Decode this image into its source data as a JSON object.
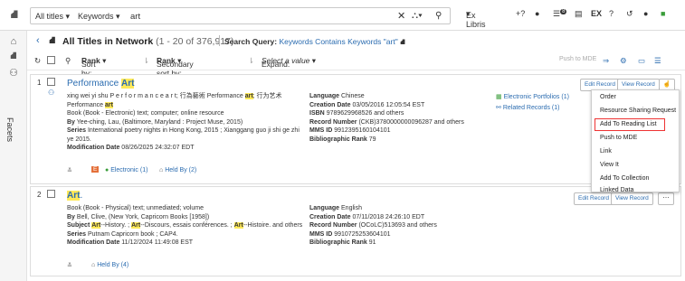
{
  "search": {
    "scope": "All titles",
    "field": "Keywords",
    "query": "art"
  },
  "header": {
    "institution": "Ex Libris",
    "notifications_badge": "8"
  },
  "left_nav": {
    "facets_label": "Facets"
  },
  "title_bar": {
    "title": "All Titles in Network",
    "count": "(1 - 20 of 376,917)",
    "search_query_label": "Search Query:",
    "search_query_value": "Keywords Contains Keywords \"art\""
  },
  "toolbar": {
    "sort_label": "Sort by:",
    "sort_value": "Rank",
    "secondary_sort_label": "Secondary sort by:",
    "secondary_sort_value": "Rank",
    "expand_label": "Expand:",
    "expand_value": "Select a value",
    "push_to_mde": "Push to MDE"
  },
  "results": [
    {
      "number": "1",
      "title_pre": "Performance ",
      "title_hl": "Art",
      "line1_pre": "xing wei yi shu P e r f o r m a n c e a r t; 行為藝術 Performance ",
      "line1_hl": "art",
      "line1_post": "; 行为艺术",
      "line2_pre": "Performance ",
      "line2_hl": "art",
      "line3": "Book (Book - Electronic) text; computer; online resource",
      "by_label": "By",
      "by_value": "Yee-ching, Lau, (Baltimore, Maryland : Project Muse, 2015)",
      "series_label": "Series",
      "series_value": "International poetry nights in Hong Kong, 2015 ; Xianggang guo ji shi ge zhi ye 2015.",
      "mod_label": "Modification Date",
      "mod_value": "08/26/2025 24:32:07 EDT",
      "language_label": "Language",
      "language_value": "Chinese",
      "creation_label": "Creation Date",
      "creation_value": "03/05/2016 12:05:54 EST",
      "isbn_label": "ISBN",
      "isbn_value": "9789629968526 and others",
      "record_label": "Record Number",
      "record_value": "(CKB)3780000000096287 and others",
      "mms_label": "MMS ID",
      "mms_value": "9912395160104101",
      "rank_label": "Bibliographic Rank",
      "rank_value": "79",
      "portfolios": "Electronic Portfolios (1)",
      "related": "Related Records (1)",
      "electronic": "Electronic (1)",
      "held_by": "Held By (2)",
      "edit_record": "Edit Record",
      "view_record": "View Record"
    },
    {
      "number": "2",
      "title_hl": "Art",
      "title_post": ".",
      "line1": "Book (Book - Physical) text; unmediated; volume",
      "by_label": "By",
      "by_value": "Bell, Clive, (New York, Capricorn Books [1958])",
      "subject_label": "Subject",
      "subject_p1": "Art",
      "subject_p2": "--History. ; ",
      "subject_p3": "Art",
      "subject_p4": "--Discours, essais conférences. ; ",
      "subject_p5": "Art",
      "subject_p6": "--Histoire. and others",
      "series_label": "Series",
      "series_value": "Putnam Capricorn book ; CAP4.",
      "mod_label": "Modification Date",
      "mod_value": "11/12/2024 11:49:08 EST",
      "language_label": "Language",
      "language_value": "English",
      "creation_label": "Creation Date",
      "creation_value": "07/11/2018 24:26:10 EDT",
      "record_label": "Record Number",
      "record_value": "(OCoLC)513693 and others",
      "mms_label": "MMS ID",
      "mms_value": "9910725253604101",
      "rank_label": "Bibliographic Rank",
      "rank_value": "91",
      "held_by": "Held By (4)",
      "edit_record": "Edit Record",
      "view_record": "View Record"
    }
  ],
  "dropdown_menu": {
    "items": [
      "Order",
      "Resource Sharing Request",
      "Add To Reading List",
      "Push to MDE",
      "Link",
      "View It",
      "Add To Collection",
      "Linked Data"
    ],
    "selected_index": 2
  },
  "colors": {
    "link": "#2b6cb0",
    "highlight": "#ffe959",
    "selection_outline": "#e33333",
    "electronic_badge": "#e4703a"
  }
}
